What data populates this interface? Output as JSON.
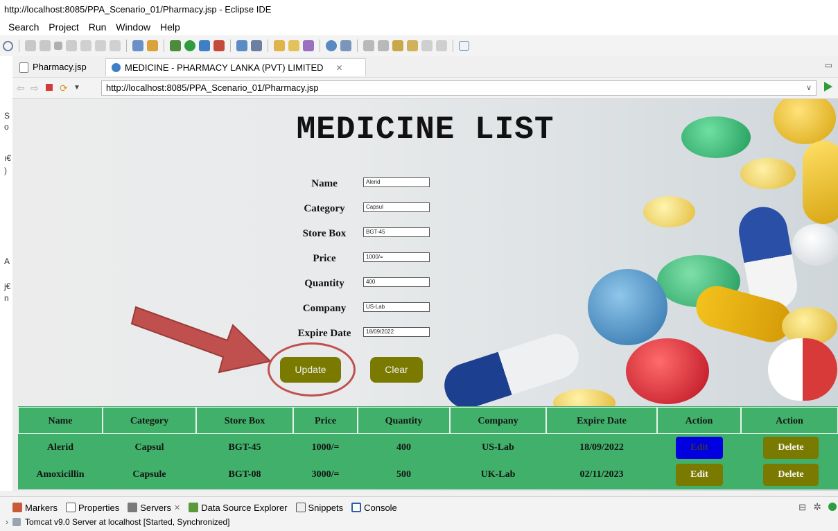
{
  "window": {
    "title": "http://localhost:8085/PPA_Scenario_01/Pharmacy.jsp - Eclipse IDE",
    "menu": [
      "Search",
      "Project",
      "Run",
      "Window",
      "Help"
    ]
  },
  "editor_tabs": [
    {
      "label": "Pharmacy.jsp",
      "icon": "jsp-file-icon"
    },
    {
      "label": "MEDICINE - PHARMACY LANKA (PVT) LIMITED",
      "icon": "globe-icon"
    }
  ],
  "browser": {
    "url": "http://localhost:8085/PPA_Scenario_01/Pharmacy.jsp"
  },
  "page": {
    "heading": "MEDICINE LIST",
    "form": [
      {
        "label": "Name",
        "value": "Alerid"
      },
      {
        "label": "Category",
        "value": "Capsul"
      },
      {
        "label": "Store Box",
        "value": "BGT-45"
      },
      {
        "label": "Price",
        "value": "1000/="
      },
      {
        "label": "Quantity",
        "value": "400"
      },
      {
        "label": "Company",
        "value": "US-Lab"
      },
      {
        "label": "Expire Date",
        "value": "18/09/2022"
      }
    ],
    "update_label": "Update",
    "clear_label": "Clear",
    "table": {
      "headers": [
        "Name",
        "Category",
        "Store Box",
        "Price",
        "Quantity",
        "Company",
        "Expire Date",
        "Action",
        "Action"
      ],
      "rows": [
        {
          "cells": [
            "Alerid",
            "Capsul",
            "BGT-45",
            "1000/=",
            "400",
            "US-Lab",
            "18/09/2022"
          ],
          "edit": "Edit",
          "delete": "Delete"
        },
        {
          "cells": [
            "Amoxicillin",
            "Capsule",
            "BGT-08",
            "3000/=",
            "500",
            "UK-Lab",
            "02/11/2023"
          ],
          "edit": "Edit",
          "delete": "Delete"
        }
      ]
    }
  },
  "bottom_panel": {
    "tabs": [
      "Markers",
      "Properties",
      "Servers",
      "Data Source Explorer",
      "Snippets",
      "Console"
    ],
    "server": "Tomcat v9.0 Server at localhost  [Started, Synchronized]"
  },
  "colors": {
    "table_green": "#40b06a",
    "olive_button": "#7a7a00",
    "edit_highlight": "#0000e0",
    "annotation_red": "#c0504d"
  }
}
